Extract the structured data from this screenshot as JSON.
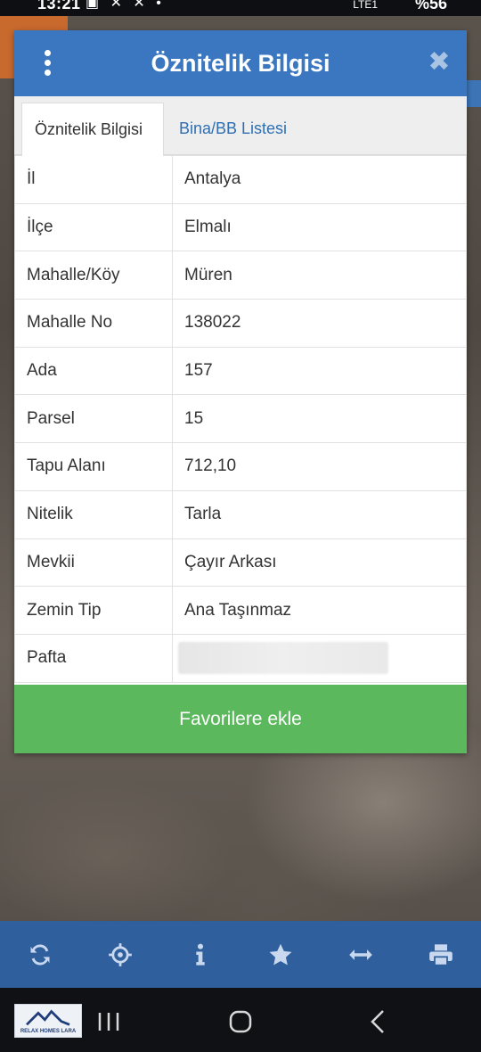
{
  "status_bar": {
    "time": "13:21",
    "network": "LTE1",
    "battery": "%56"
  },
  "dialog": {
    "title": "Öznitelik Bilgisi",
    "tabs": [
      {
        "label": "Öznitelik Bilgisi",
        "active": true
      },
      {
        "label": "Bina/BB Listesi",
        "active": false
      }
    ],
    "rows": [
      {
        "label": "İl",
        "value": "Antalya"
      },
      {
        "label": "İlçe",
        "value": "Elmalı"
      },
      {
        "label": "Mahalle/Köy",
        "value": "Müren"
      },
      {
        "label": "Mahalle No",
        "value": "138022"
      },
      {
        "label": "Ada",
        "value": "157"
      },
      {
        "label": "Parsel",
        "value": "15"
      },
      {
        "label": "Tapu Alanı",
        "value": "712,10"
      },
      {
        "label": "Nitelik",
        "value": "Tarla"
      },
      {
        "label": "Mevkii",
        "value": "Çayır Arkası"
      },
      {
        "label": "Zemin Tip",
        "value": "Ana Taşınmaz"
      },
      {
        "label": "Pafta",
        "value": ""
      }
    ],
    "favorite_button": "Favorilere ekle"
  },
  "toolbar": {
    "icons": [
      "refresh-icon",
      "locate-icon",
      "info-icon",
      "star-icon",
      "measure-icon",
      "print-icon"
    ]
  },
  "navbar": {
    "logo_text": "RELAX HOMES LARA"
  },
  "colors": {
    "header": "#3a77c0",
    "toolbar": "#2f5f9c",
    "favorite": "#5cb85c",
    "tab_link": "#2f6fb2"
  }
}
